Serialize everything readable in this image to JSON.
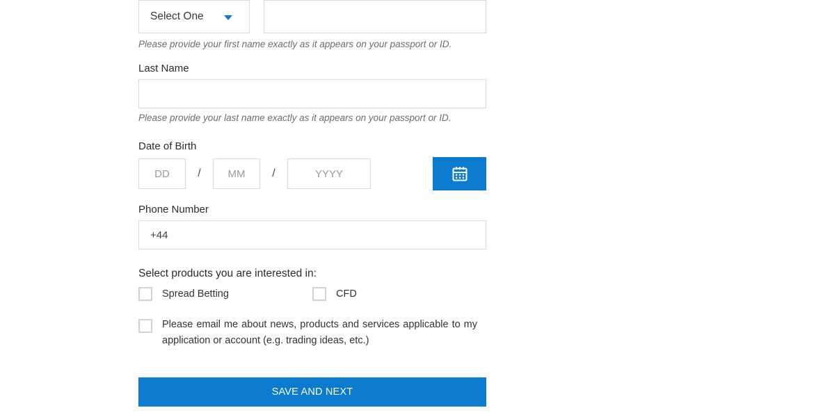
{
  "theme": {
    "accent": "#0b7bd0",
    "border": "#dcdcdc",
    "checkbox_border": "#d2d2d2",
    "label_color": "#2b2b2b",
    "helper_color": "#6d6d6d",
    "placeholder_color": "#9a9a9a"
  },
  "title_field": {
    "selected_option": "Select One",
    "options": [
      "Select One"
    ],
    "caret_icon": "chevron-down-icon"
  },
  "first_name": {
    "value": "",
    "placeholder": "",
    "helper": "Please provide your first name exactly as it appears on your passport or ID."
  },
  "last_name": {
    "label": "Last Name",
    "value": "",
    "placeholder": "",
    "helper": "Please provide your last name exactly as it appears on your passport or ID."
  },
  "date_of_birth": {
    "label": "Date of Birth",
    "day": {
      "value": "",
      "placeholder": "DD"
    },
    "separator_1": "/",
    "month": {
      "value": "",
      "placeholder": "MM"
    },
    "separator_2": "/",
    "year": {
      "value": "",
      "placeholder": "YYYY"
    },
    "calendar_button": {
      "icon": "calendar-icon",
      "label": ""
    }
  },
  "phone": {
    "label": "Phone Number",
    "value": "+44",
    "placeholder": ""
  },
  "products": {
    "title": "Select products you are interested in:",
    "items": [
      {
        "label": "Spread Betting",
        "checked": false
      },
      {
        "label": "CFD",
        "checked": false
      }
    ]
  },
  "consent": {
    "text": "Please email me about news, products and services applicable to my application or account (e.g. trading ideas, etc.)",
    "checked": false
  },
  "submit": {
    "label": "SAVE AND NEXT"
  }
}
